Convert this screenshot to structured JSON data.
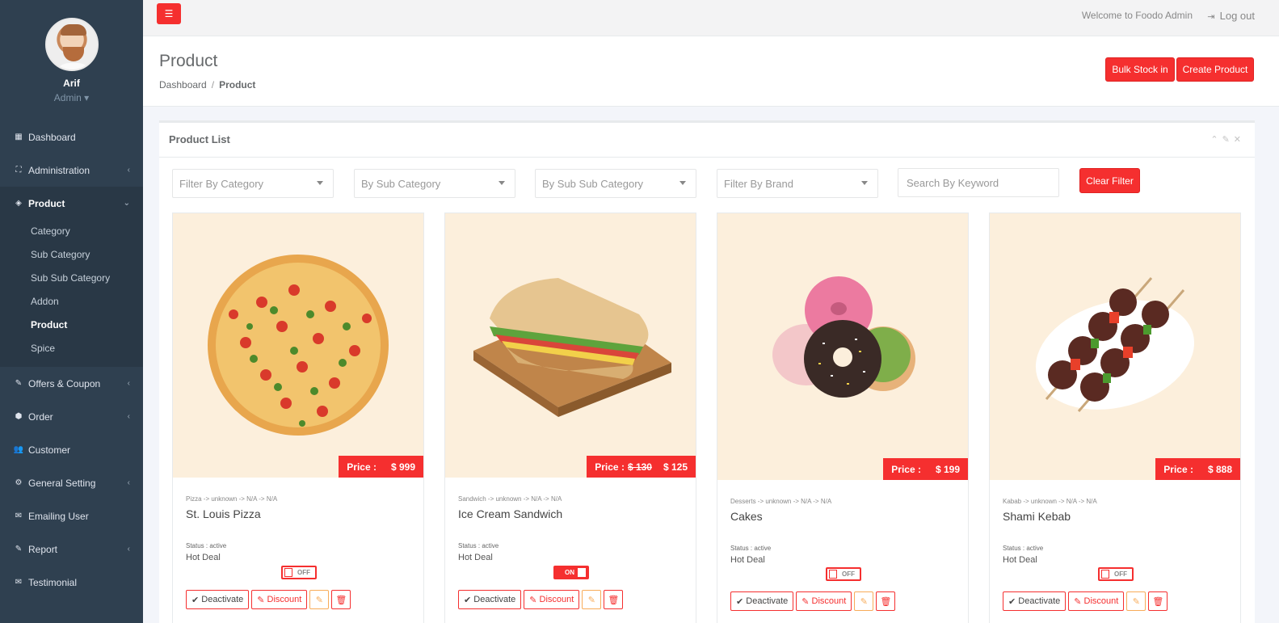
{
  "sidebar": {
    "user_name": "Arif",
    "user_role": "Admin",
    "items": [
      {
        "label": "Dashboard",
        "icon": "th-large-icon"
      },
      {
        "label": "Administration",
        "icon": "sitemap-icon"
      },
      {
        "label": "Product",
        "icon": "diamond-icon"
      },
      {
        "label": "Offers & Coupon",
        "icon": "tag-icon"
      },
      {
        "label": "Order",
        "icon": "cube-icon"
      },
      {
        "label": "Customer",
        "icon": "users-icon"
      },
      {
        "label": "General Setting",
        "icon": "gear-icon"
      },
      {
        "label": "Emailing User",
        "icon": "envelope-icon"
      },
      {
        "label": "Report",
        "icon": "tag-icon"
      },
      {
        "label": "Testimonial",
        "icon": "envelope-icon"
      }
    ],
    "product_sub": [
      "Category",
      "Sub Category",
      "Sub Sub Category",
      "Addon",
      "Product",
      "Spice"
    ]
  },
  "topbar": {
    "welcome": "Welcome to Foodo Admin",
    "logout": "Log out"
  },
  "heading": {
    "title": "Product",
    "breadcrumb": [
      "Dashboard",
      "Product"
    ],
    "bulk_label": "Bulk Stock in",
    "create_label": "Create Product"
  },
  "panel": {
    "title": "Product List",
    "filters": [
      "Filter By Category",
      "By Sub Category",
      "By Sub Sub Category",
      "Filter By Brand"
    ],
    "search_placeholder": "Search By Keyword",
    "clear_label": "Clear Filter"
  },
  "products": [
    {
      "crumb": "Pizza -> unknown -> N/A -> N/A",
      "name": "St. Louis Pizza",
      "price_label": "Price :",
      "old_price": "",
      "price": "$ 999",
      "status": "Status : active",
      "hot": "Hot Deal",
      "toggle": "OFF"
    },
    {
      "crumb": "Sandwich -> unknown -> N/A -> N/A",
      "name": "Ice Cream Sandwich",
      "price_label": "Price :",
      "old_price": "$ 130",
      "price": "$ 125",
      "status": "Status : active",
      "hot": "Hot Deal",
      "toggle": "ON"
    },
    {
      "crumb": "Desserts -> unknown -> N/A -> N/A",
      "name": "Cakes",
      "price_label": "Price :",
      "old_price": "",
      "price": "$ 199",
      "status": "Status : active",
      "hot": "Hot Deal",
      "toggle": "OFF"
    },
    {
      "crumb": "Kabab -> unknown -> N/A -> N/A",
      "name": "Shami Kebab",
      "price_label": "Price :",
      "old_price": "",
      "price": "$ 888",
      "status": "Status : active",
      "hot": "Hot Deal",
      "toggle": "OFF"
    }
  ],
  "card_actions": {
    "deactivate": "Deactivate",
    "discount": "Discount"
  },
  "colors": {
    "accent": "#f52f2f",
    "sidebar": "#2f4050",
    "card_bg": "#fcefdc"
  }
}
